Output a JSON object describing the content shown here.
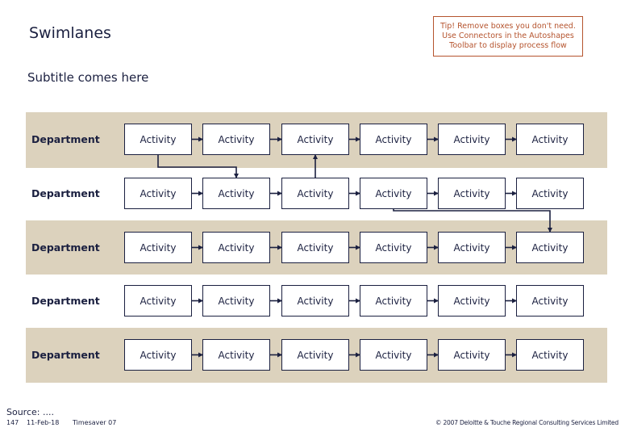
{
  "header": {
    "title": "Swimlanes",
    "subtitle": "Subtitle comes here",
    "tip": "Tip! Remove boxes you don't need. Use Connectors in the Autoshapes Toolbar to display process flow"
  },
  "colors": {
    "lane_shade": "#dcd2bd",
    "text": "#1b2040",
    "tip_accent": "#b5542e",
    "connector": "#1b2040"
  },
  "lanes": [
    {
      "department": "Department",
      "shaded": true,
      "activities": [
        "Activity",
        "Activity",
        "Activity",
        "Activity",
        "Activity",
        "Activity"
      ]
    },
    {
      "department": "Department",
      "shaded": false,
      "activities": [
        "Activity",
        "Activity",
        "Activity",
        "Activity",
        "Activity",
        "Activity"
      ]
    },
    {
      "department": "Department",
      "shaded": true,
      "activities": [
        "Activity",
        "Activity",
        "Activity",
        "Activity",
        "Activity",
        "Activity"
      ]
    },
    {
      "department": "Department",
      "shaded": false,
      "activities": [
        "Activity",
        "Activity",
        "Activity",
        "Activity",
        "Activity",
        "Activity"
      ]
    },
    {
      "department": "Department",
      "shaded": true,
      "activities": [
        "Activity",
        "Activity",
        "Activity",
        "Activity",
        "Activity",
        "Activity"
      ]
    }
  ],
  "flows": [
    {
      "type": "sequential",
      "note": "each activity points to the next activity in the same lane"
    },
    {
      "from": [
        0,
        0
      ],
      "to": [
        1,
        1
      ],
      "type": "cross-lane"
    },
    {
      "from": [
        1,
        2
      ],
      "to": [
        0,
        2
      ],
      "type": "cross-lane"
    },
    {
      "from": [
        1,
        3
      ],
      "to": [
        2,
        5
      ],
      "type": "cross-lane"
    }
  ],
  "footer": {
    "source": "Source: ....",
    "page_number": "147",
    "date": "11-Feb-18",
    "template": "Timesaver 07",
    "copyright": "© 2007 Deloitte & Touche Regional Consulting Services Limited"
  }
}
